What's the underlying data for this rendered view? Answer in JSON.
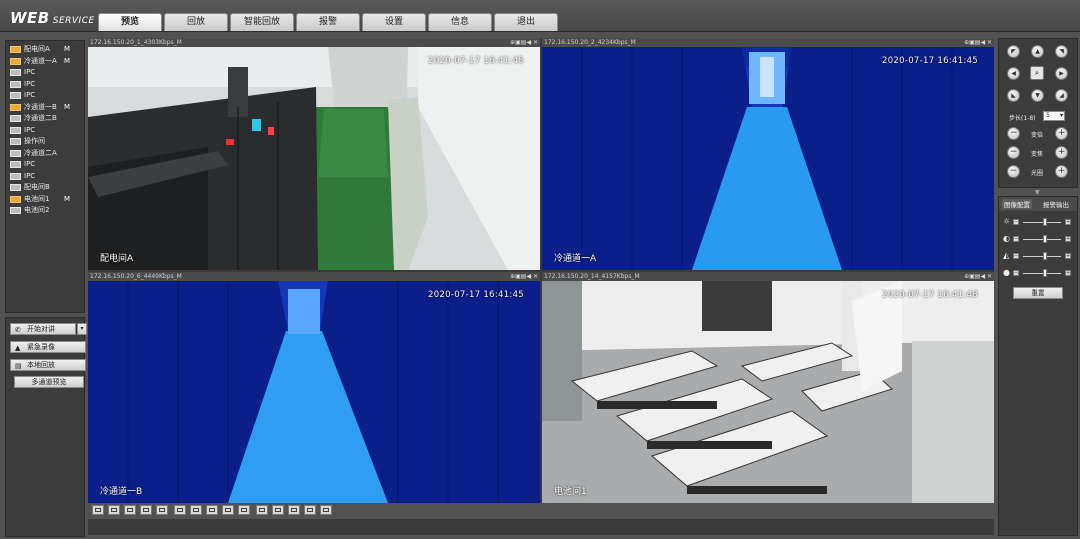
{
  "header": {
    "logo_web": "WEB",
    "logo_service": "SERVICE",
    "tabs": [
      "预览",
      "回放",
      "智能回放",
      "报警",
      "设置",
      "信息",
      "退出"
    ]
  },
  "sidebar": {
    "channels": [
      {
        "label": "配电间A",
        "flag": "M",
        "icon": "folder-camera-icon"
      },
      {
        "label": "冷通道一A",
        "flag": "M",
        "icon": "folder-camera-icon"
      },
      {
        "label": "IPC",
        "flag": "",
        "icon": "camera-icon"
      },
      {
        "label": "IPC",
        "flag": "",
        "icon": "camera-icon"
      },
      {
        "label": "IPC",
        "flag": "",
        "icon": "camera-icon"
      },
      {
        "label": "冷通道一B",
        "flag": "M",
        "icon": "folder-camera-icon"
      },
      {
        "label": "冷通道二B",
        "flag": "",
        "icon": "camera-icon"
      },
      {
        "label": "IPC",
        "flag": "",
        "icon": "camera-icon"
      },
      {
        "label": "操作间",
        "flag": "",
        "icon": "camera-icon"
      },
      {
        "label": "冷通道二A",
        "flag": "",
        "icon": "camera-icon"
      },
      {
        "label": "IPC",
        "flag": "",
        "icon": "camera-icon"
      },
      {
        "label": "IPC",
        "flag": "",
        "icon": "camera-icon"
      },
      {
        "label": "配电间B",
        "flag": "",
        "icon": "camera-icon"
      },
      {
        "label": "电池间1",
        "flag": "M",
        "icon": "folder-camera-icon"
      },
      {
        "label": "电池间2",
        "flag": "",
        "icon": "camera-icon"
      }
    ],
    "controls": {
      "talk": "开始对讲",
      "record": "紧急录像",
      "local_playback": "本地回放",
      "multi_preview": "多通道预览"
    }
  },
  "video": {
    "panes": [
      {
        "header": "172.16.150.20_1_4303Kbps_M",
        "timestamp": "2020-07-17 16:41:45",
        "label": "配电间A",
        "scene": "power-room",
        "selected": true
      },
      {
        "header": "172.16.150.20_2_4234Kbps_M",
        "timestamp": "2020-07-17 16:41:45",
        "label": "冷通道一A",
        "scene": "cold-aisle",
        "selected": false
      },
      {
        "header": "172.16.150.20_6_4449Kbps_M",
        "timestamp": "2020-07-17 16:41:45",
        "label": "冷通道一B",
        "scene": "cold-aisle",
        "selected": false
      },
      {
        "header": "172.16.150.20_14_4157Kbps_M",
        "timestamp": "2020-07-17 16:41:48",
        "label": "电池间1",
        "scene": "battery-room",
        "selected": false
      }
    ],
    "pane_icons": "⊕▣▤◀ ✕"
  },
  "ptz": {
    "step_label": "步长(1-8)",
    "step_value": "5",
    "rows": [
      {
        "label": "变倍"
      },
      {
        "label": "变焦"
      },
      {
        "label": "光圈"
      }
    ]
  },
  "image_settings": {
    "tabs": [
      "图像配置",
      "报警输出"
    ],
    "sliders": [
      {
        "name": "brightness",
        "icon": "☼",
        "level": 0.55
      },
      {
        "name": "contrast",
        "icon": "◐",
        "level": 0.55
      },
      {
        "name": "saturation",
        "icon": "◭",
        "level": 0.55
      },
      {
        "name": "hue",
        "icon": "●",
        "level": 0.55
      }
    ],
    "reset": "重置"
  },
  "colors": {
    "accent_selected": "#29b34a",
    "tab_bg": "#e0e0e0",
    "panel_bg": "#3c3c3c"
  }
}
